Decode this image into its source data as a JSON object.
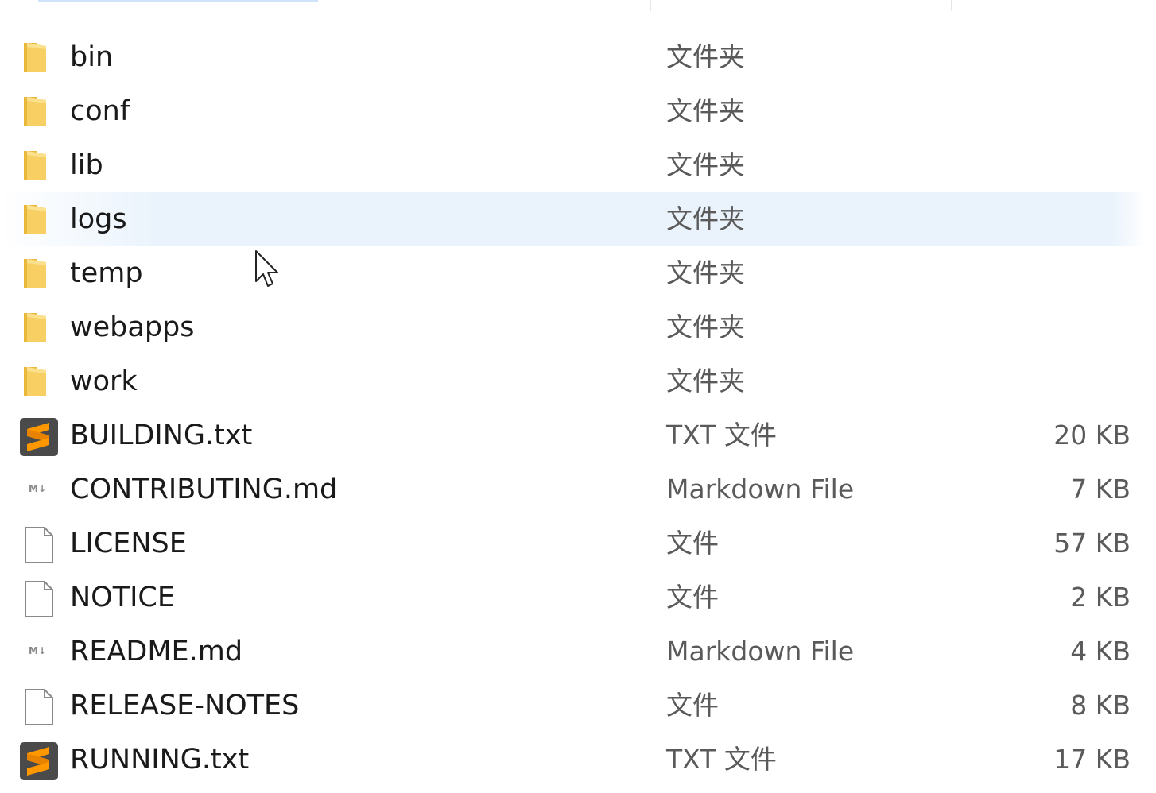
{
  "file_list": {
    "items": [
      {
        "name": "bin",
        "type": "文件夹",
        "size": "",
        "icon": "folder-icon"
      },
      {
        "name": "conf",
        "type": "文件夹",
        "size": "",
        "icon": "folder-icon"
      },
      {
        "name": "lib",
        "type": "文件夹",
        "size": "",
        "icon": "folder-icon"
      },
      {
        "name": "logs",
        "type": "文件夹",
        "size": "",
        "icon": "folder-icon",
        "hovered": true
      },
      {
        "name": "temp",
        "type": "文件夹",
        "size": "",
        "icon": "folder-icon"
      },
      {
        "name": "webapps",
        "type": "文件夹",
        "size": "",
        "icon": "folder-icon"
      },
      {
        "name": "work",
        "type": "文件夹",
        "size": "",
        "icon": "folder-icon"
      },
      {
        "name": "BUILDING.txt",
        "type": "TXT 文件",
        "size": "20 KB",
        "icon": "sublime-text-icon"
      },
      {
        "name": "CONTRIBUTING.md",
        "type": "Markdown File",
        "size": "7 KB",
        "icon": "markdown-icon"
      },
      {
        "name": "LICENSE",
        "type": "文件",
        "size": "57 KB",
        "icon": "file-icon"
      },
      {
        "name": "NOTICE",
        "type": "文件",
        "size": "2 KB",
        "icon": "file-icon"
      },
      {
        "name": "README.md",
        "type": "Markdown File",
        "size": "4 KB",
        "icon": "markdown-icon"
      },
      {
        "name": "RELEASE-NOTES",
        "type": "文件",
        "size": "8 KB",
        "icon": "file-icon"
      },
      {
        "name": "RUNNING.txt",
        "type": "TXT 文件",
        "size": "17 KB",
        "icon": "sublime-text-icon"
      }
    ]
  },
  "colors": {
    "hover_row": "#eaf3fc",
    "folder": "#f4c44e",
    "sublime_bg": "#4a4a4a",
    "sublime_accent": "#ff9800"
  }
}
